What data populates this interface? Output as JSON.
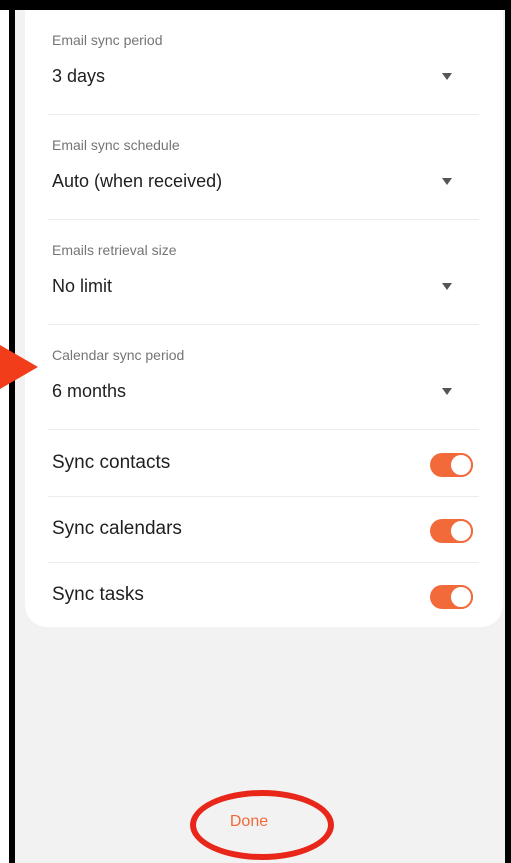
{
  "settings": {
    "email_sync_period": {
      "label": "Email sync period",
      "value": "3 days"
    },
    "email_sync_schedule": {
      "label": "Email sync schedule",
      "value": "Auto (when received)"
    },
    "emails_retrieval_size": {
      "label": "Emails retrieval size",
      "value": "No limit"
    },
    "calendar_sync_period": {
      "label": "Calendar sync period",
      "value": "6 months"
    },
    "sync_contacts": {
      "label": "Sync contacts",
      "enabled": true
    },
    "sync_calendars": {
      "label": "Sync calendars",
      "enabled": true
    },
    "sync_tasks": {
      "label": "Sync tasks",
      "enabled": true
    }
  },
  "footer": {
    "done_label": "Done"
  },
  "colors": {
    "accent": "#f26a3a",
    "annotation": "#e8261a",
    "background": "#f2f2f2",
    "card": "#ffffff"
  },
  "icons": {
    "dropdown": "caret-down-icon",
    "annotation_arrow": "arrow-right-icon"
  }
}
